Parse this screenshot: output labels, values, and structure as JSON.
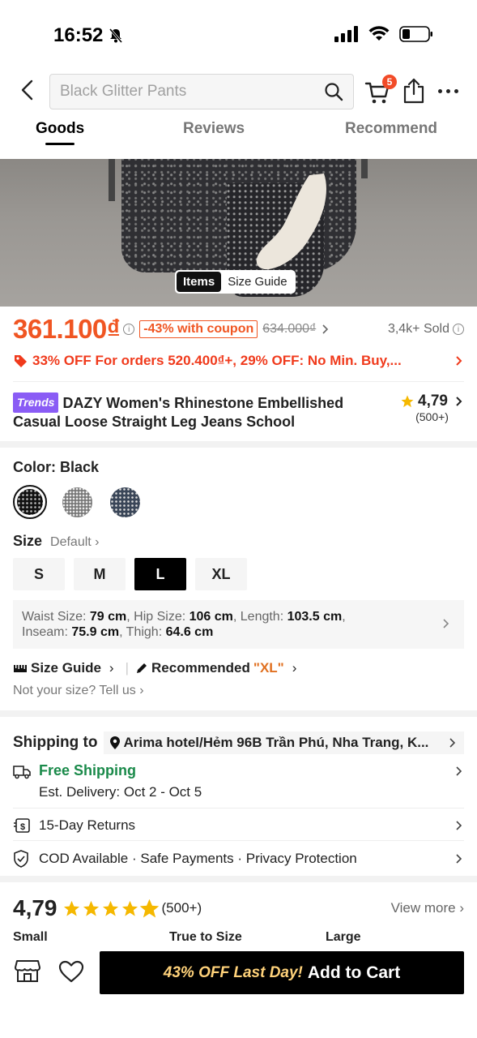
{
  "status_bar": {
    "time": "16:52"
  },
  "search": {
    "placeholder": "Black Glitter Pants"
  },
  "cart": {
    "badge": "5"
  },
  "tabs": [
    "Goods",
    "Reviews",
    "Recommend"
  ],
  "image_toggle": {
    "items": "Items",
    "size_guide": "Size Guide"
  },
  "price": {
    "current": "361.100₫",
    "coupon": "-43% with coupon",
    "original": "634.000₫",
    "sold": "3,4k+ Sold"
  },
  "promo": {
    "text": "33% OFF For orders 520.400₫+,  29% OFF: No Min. Buy,..."
  },
  "product": {
    "badge": "Trends",
    "title": "DAZY Women's Rhinestone Embellished Casual Loose Straight Leg Jeans School",
    "rating": "4,79",
    "rating_count": "(500+)"
  },
  "color": {
    "label": "Color: Black"
  },
  "size": {
    "label": "Size",
    "default": "Default",
    "options": [
      "S",
      "M",
      "L",
      "XL"
    ],
    "selected": "L"
  },
  "measure": {
    "waist_lbl": "Waist Size: ",
    "waist": "79 cm",
    "hip_lbl": ", Hip Size: ",
    "hip": "106 cm",
    "length_lbl": ", Length: ",
    "length": "103.5 cm",
    "inseam_lbl": "Inseam: ",
    "inseam": "75.9 cm",
    "thigh_lbl": ", Thigh: ",
    "thigh": "64.6 cm"
  },
  "guide": {
    "size_guide": "Size Guide",
    "recommended": "Recommended",
    "recommended_value": "\"XL\"",
    "not_your_size": "Not your size? Tell us"
  },
  "shipping": {
    "label": "Shipping to",
    "address": "Arima hotel/Hẻm 96B Trần Phú, Nha Trang, K...",
    "free": "Free Shipping",
    "delivery": "Est. Delivery: Oct 2 - Oct 5",
    "returns": "15-Day Returns",
    "payments": "COD Available · Safe Payments · Privacy Protection"
  },
  "reviews": {
    "rating": "4,79",
    "count": "(500+)",
    "view_more": "View more",
    "fit": [
      "Small",
      "True to Size",
      "Large"
    ]
  },
  "cta": {
    "discount": "43% OFF Last Day!",
    "label": "Add to Cart"
  },
  "colors": {
    "accent": "#f05522",
    "promo": "#f03a1c",
    "free_shipping": "#1a8a4a",
    "star": "#f5b800"
  }
}
